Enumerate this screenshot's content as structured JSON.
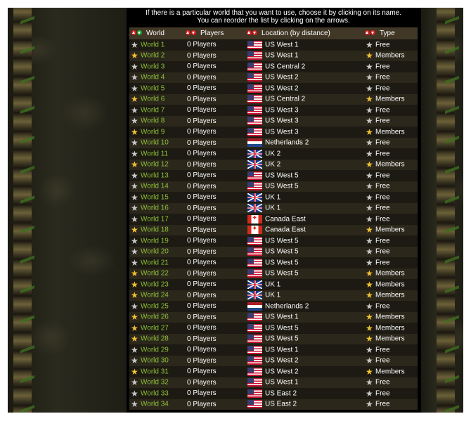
{
  "notice": {
    "line1": "If there is a particular world that you want to use, choose it by clicking on its name.",
    "line2": "You can reorder the list by clicking on the arrows."
  },
  "headers": {
    "world": "World",
    "players": "Players",
    "location": "Location (by distance)",
    "type": "Type"
  },
  "icons": {
    "sort_up": "sort-up-arrow-icon",
    "sort_down": "sort-down-arrow-icon",
    "member_star": "gold-star-icon",
    "free_star": "grey-star-icon"
  },
  "colors": {
    "world_link": "#8fc03a",
    "header_bg": "#403726",
    "member_star": "#f2c230",
    "free_star": "#c9c9c9"
  },
  "worlds": [
    {
      "name": "World 1",
      "players": "0 Players",
      "location": "US West 1",
      "flag": "us",
      "type": "Free"
    },
    {
      "name": "World 2",
      "players": "0 Players",
      "location": "US West 1",
      "flag": "us",
      "type": "Members"
    },
    {
      "name": "World 3",
      "players": "0 Players",
      "location": "US Central 2",
      "flag": "us",
      "type": "Free"
    },
    {
      "name": "World 4",
      "players": "0 Players",
      "location": "US West 2",
      "flag": "us",
      "type": "Free"
    },
    {
      "name": "World 5",
      "players": "0 Players",
      "location": "US West 2",
      "flag": "us",
      "type": "Free"
    },
    {
      "name": "World 6",
      "players": "0 Players",
      "location": "US Central 2",
      "flag": "us",
      "type": "Members"
    },
    {
      "name": "World 7",
      "players": "0 Players",
      "location": "US West 3",
      "flag": "us",
      "type": "Free"
    },
    {
      "name": "World 8",
      "players": "0 Players",
      "location": "US West 3",
      "flag": "us",
      "type": "Free"
    },
    {
      "name": "World 9",
      "players": "0 Players",
      "location": "US West 3",
      "flag": "us",
      "type": "Members"
    },
    {
      "name": "World 10",
      "players": "0 Players",
      "location": "Netherlands 2",
      "flag": "nl",
      "type": "Free"
    },
    {
      "name": "World 11",
      "players": "0 Players",
      "location": "UK 2",
      "flag": "uk",
      "type": "Free"
    },
    {
      "name": "World 12",
      "players": "0 Players",
      "location": "UK 2",
      "flag": "uk",
      "type": "Members"
    },
    {
      "name": "World 13",
      "players": "0 Players",
      "location": "US West 5",
      "flag": "us",
      "type": "Free"
    },
    {
      "name": "World 14",
      "players": "0 Players",
      "location": "US West 5",
      "flag": "us",
      "type": "Free"
    },
    {
      "name": "World 15",
      "players": "0 Players",
      "location": "UK 1",
      "flag": "uk",
      "type": "Free"
    },
    {
      "name": "World 16",
      "players": "0 Players",
      "location": "UK 1",
      "flag": "uk",
      "type": "Free"
    },
    {
      "name": "World 17",
      "players": "0 Players",
      "location": "Canada East",
      "flag": "ca",
      "type": "Free"
    },
    {
      "name": "World 18",
      "players": "0 Players",
      "location": "Canada East",
      "flag": "ca",
      "type": "Members"
    },
    {
      "name": "World 19",
      "players": "0 Players",
      "location": "US West 5",
      "flag": "us",
      "type": "Free"
    },
    {
      "name": "World 20",
      "players": "0 Players",
      "location": "US West 5",
      "flag": "us",
      "type": "Free"
    },
    {
      "name": "World 21",
      "players": "0 Players",
      "location": "US West 5",
      "flag": "us",
      "type": "Free"
    },
    {
      "name": "World 22",
      "players": "0 Players",
      "location": "US West 5",
      "flag": "us",
      "type": "Members"
    },
    {
      "name": "World 23",
      "players": "0 Players",
      "location": "UK 1",
      "flag": "uk",
      "type": "Members"
    },
    {
      "name": "World 24",
      "players": "0 Players",
      "location": "UK 1",
      "flag": "uk",
      "type": "Members"
    },
    {
      "name": "World 25",
      "players": "0 Players",
      "location": "Netherlands 2",
      "flag": "nl",
      "type": "Free"
    },
    {
      "name": "World 26",
      "players": "0 Players",
      "location": "US West 1",
      "flag": "us",
      "type": "Members"
    },
    {
      "name": "World 27",
      "players": "0 Players",
      "location": "US West 5",
      "flag": "us",
      "type": "Members"
    },
    {
      "name": "World 28",
      "players": "0 Players",
      "location": "US West 5",
      "flag": "us",
      "type": "Members"
    },
    {
      "name": "World 29",
      "players": "0 Players",
      "location": "US West 1",
      "flag": "us",
      "type": "Free"
    },
    {
      "name": "World 30",
      "players": "0 Players",
      "location": "US West 2",
      "flag": "us",
      "type": "Free"
    },
    {
      "name": "World 31",
      "players": "0 Players",
      "location": "US West 2",
      "flag": "us",
      "type": "Members"
    },
    {
      "name": "World 32",
      "players": "0 Players",
      "location": "US West 1",
      "flag": "us",
      "type": "Free"
    },
    {
      "name": "World 33",
      "players": "0 Players",
      "location": "US East 2",
      "flag": "us",
      "type": "Free"
    },
    {
      "name": "World 34",
      "players": "0 Players",
      "location": "US East 2",
      "flag": "us",
      "type": "Free"
    }
  ]
}
